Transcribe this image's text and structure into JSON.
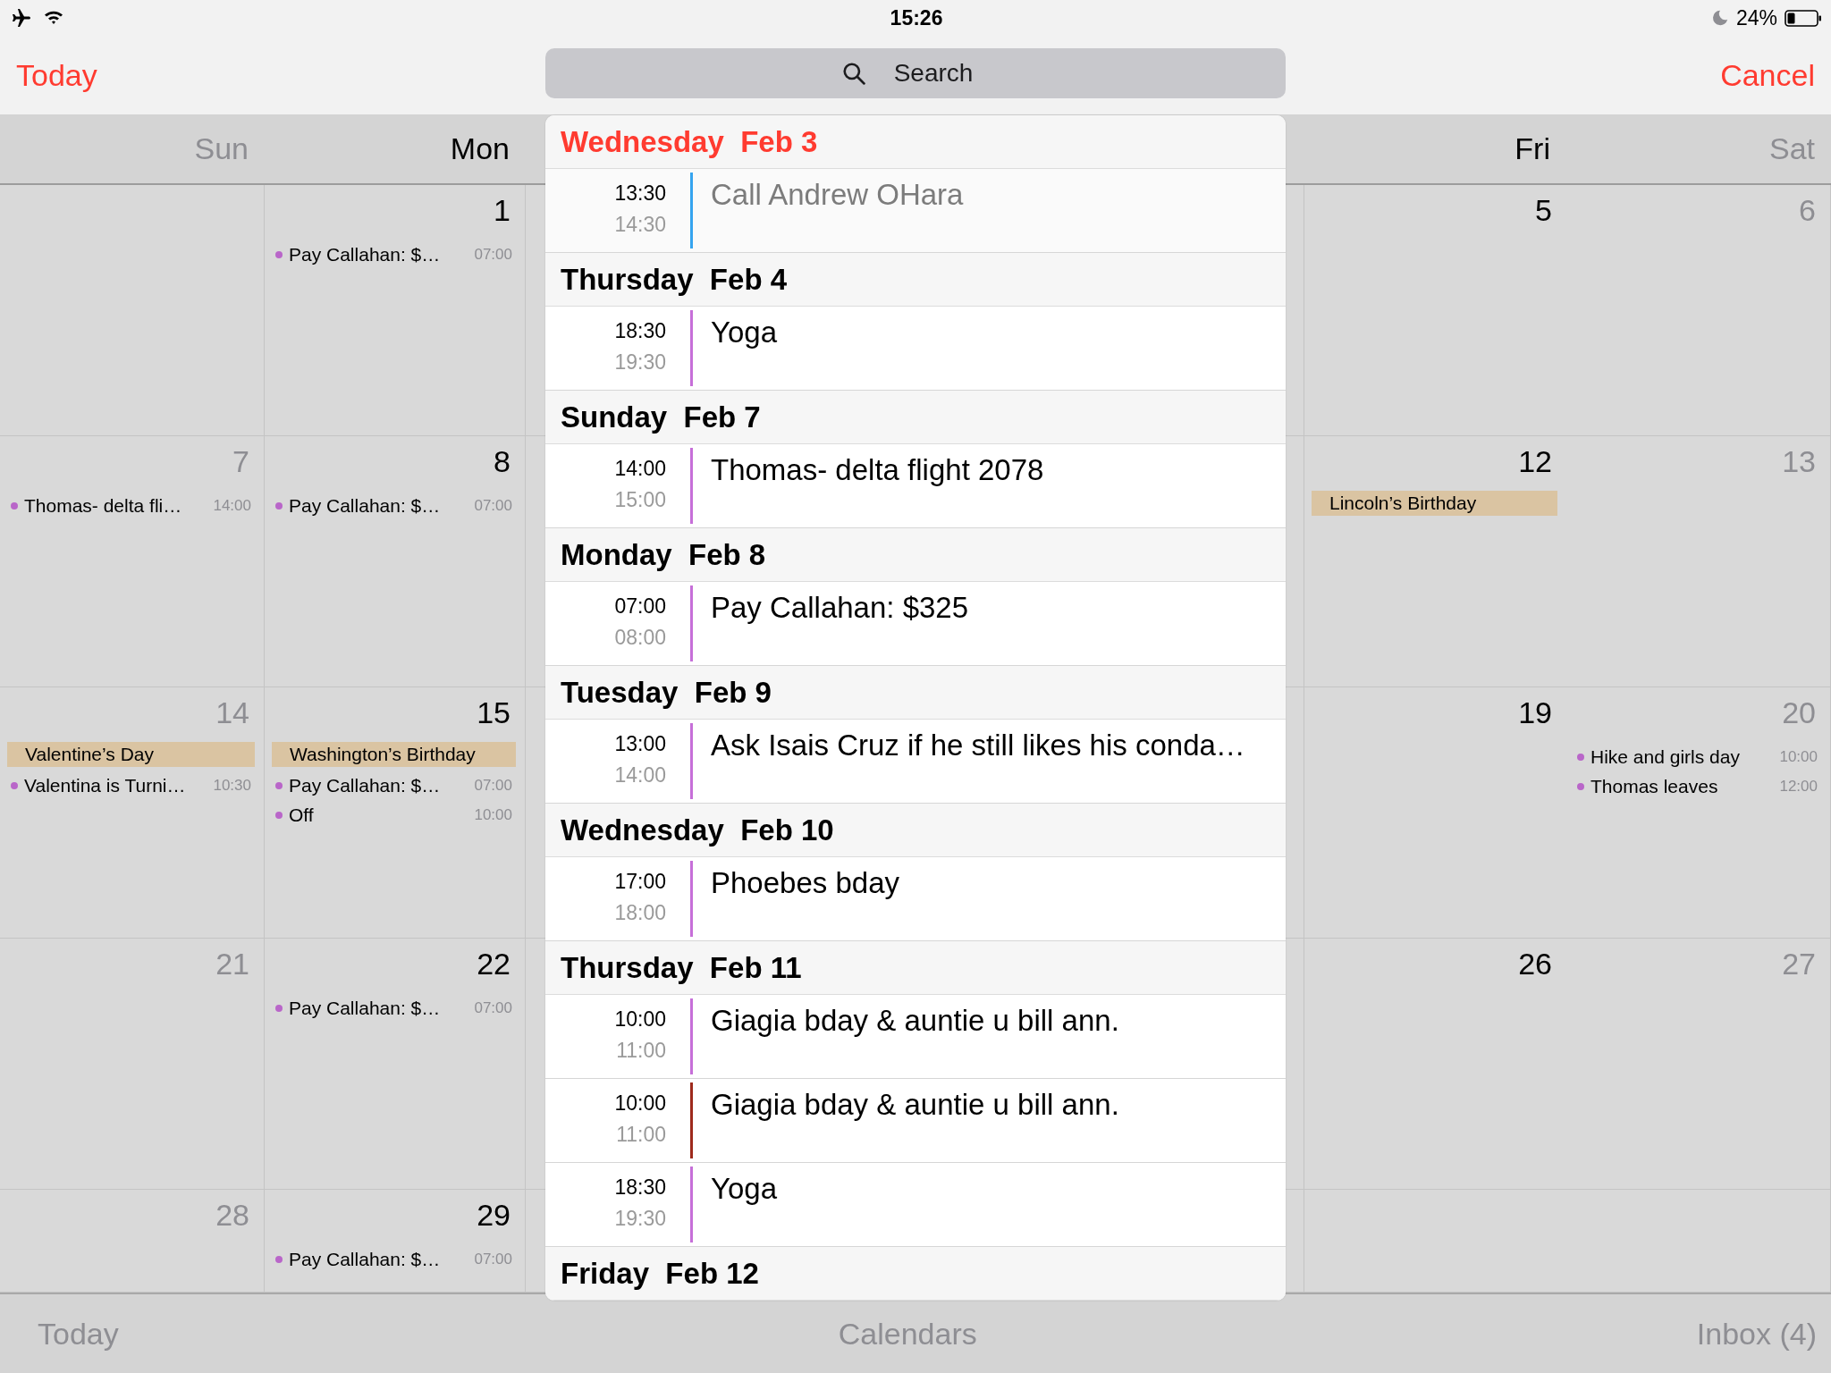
{
  "status_bar": {
    "time": "15:26",
    "battery": "24%"
  },
  "nav_bar": {
    "today": "Today",
    "search_placeholder": "Search",
    "cancel": "Cancel"
  },
  "calendar": {
    "weekdays": {
      "sun": {
        "label": "Sun",
        "weekend": true
      },
      "mon": {
        "label": "Mon",
        "weekend": false
      },
      "fri": {
        "label": "Fri",
        "weekend": false
      },
      "sat": {
        "label": "Sat",
        "weekend": true
      }
    },
    "weeks": [
      {
        "mon": {
          "number": "1",
          "events": [
            {
              "title": "Pay Callahan: $…",
              "time": "07:00"
            }
          ]
        },
        "fri": {
          "number": "5"
        },
        "sat": {
          "number": "6"
        }
      },
      {
        "sun": {
          "number": "7",
          "events": [
            {
              "title": "Thomas- delta fli…",
              "time": "14:00"
            }
          ]
        },
        "mon": {
          "number": "8",
          "events": [
            {
              "title": "Pay Callahan: $…",
              "time": "07:00"
            }
          ]
        },
        "fri": {
          "number": "12",
          "holidays": [
            "Lincoln’s Birthday"
          ]
        },
        "sat": {
          "number": "13"
        }
      },
      {
        "sun": {
          "number": "14",
          "holidays": [
            "Valentine’s Day"
          ],
          "events": [
            {
              "title": "Valentina is Turni…",
              "time": "10:30"
            }
          ]
        },
        "mon": {
          "number": "15",
          "holidays": [
            "Washington’s Birthday"
          ],
          "events": [
            {
              "title": "Pay Callahan: $…",
              "time": "07:00"
            },
            {
              "title": "Off",
              "time": "10:00"
            }
          ]
        },
        "fri": {
          "number": "19"
        },
        "sat": {
          "number": "20",
          "events": [
            {
              "title": "Hike and girls day",
              "time": "10:00"
            },
            {
              "title": "Thomas leaves",
              "time": "12:00"
            }
          ]
        }
      },
      {
        "sun": {
          "number": "21"
        },
        "mon": {
          "number": "22",
          "events": [
            {
              "title": "Pay Callahan: $…",
              "time": "07:00"
            }
          ]
        },
        "fri": {
          "number": "26"
        },
        "sat": {
          "number": "27"
        }
      },
      {
        "sun": {
          "number": "28"
        },
        "mon": {
          "number": "29",
          "events": [
            {
              "title": "Pay Callahan: $…",
              "time": "07:00"
            }
          ]
        }
      }
    ]
  },
  "results": [
    {
      "heading": "Wednesday  Feb 3",
      "today": true,
      "events": [
        {
          "start": "13:30",
          "end": "14:30",
          "title": "Call Andrew OHara",
          "color": "#35a4ef",
          "dimmed": true
        }
      ]
    },
    {
      "heading": "Thursday  Feb 4",
      "today": false,
      "events": [
        {
          "start": "18:30",
          "end": "19:30",
          "title": "Yoga",
          "color": "#c66fd8",
          "dimmed": false
        }
      ]
    },
    {
      "heading": "Sunday  Feb 7",
      "today": false,
      "events": [
        {
          "start": "14:00",
          "end": "15:00",
          "title": "Thomas- delta flight 2078",
          "color": "#c66fd8",
          "dimmed": false
        }
      ]
    },
    {
      "heading": "Monday  Feb 8",
      "today": false,
      "events": [
        {
          "start": "07:00",
          "end": "08:00",
          "title": "Pay Callahan: $325",
          "color": "#c66fd8",
          "dimmed": false
        }
      ]
    },
    {
      "heading": "Tuesday  Feb 9",
      "today": false,
      "events": [
        {
          "start": "13:00",
          "end": "14:00",
          "title": "Ask Isais Cruz if he still likes his conda…",
          "color": "#c66fd8",
          "dimmed": false
        }
      ]
    },
    {
      "heading": "Wednesday  Feb 10",
      "today": false,
      "events": [
        {
          "start": "17:00",
          "end": "18:00",
          "title": "Phoebes bday",
          "color": "#c66fd8",
          "dimmed": false
        }
      ]
    },
    {
      "heading": "Thursday  Feb 11",
      "today": false,
      "events": [
        {
          "start": "10:00",
          "end": "11:00",
          "title": "Giagia bday & auntie u bill ann.",
          "color": "#c66fd8",
          "dimmed": false
        },
        {
          "start": "10:00",
          "end": "11:00",
          "title": "Giagia bday & auntie u bill ann.",
          "color": "#9e2a1c",
          "dimmed": false
        },
        {
          "start": "18:30",
          "end": "19:30",
          "title": "Yoga",
          "color": "#c66fd8",
          "dimmed": false
        }
      ]
    },
    {
      "heading": "Friday  Feb 12",
      "today": false
    }
  ],
  "toolbar": {
    "today": "Today",
    "calendars": "Calendars",
    "inbox": "Inbox (4)"
  }
}
